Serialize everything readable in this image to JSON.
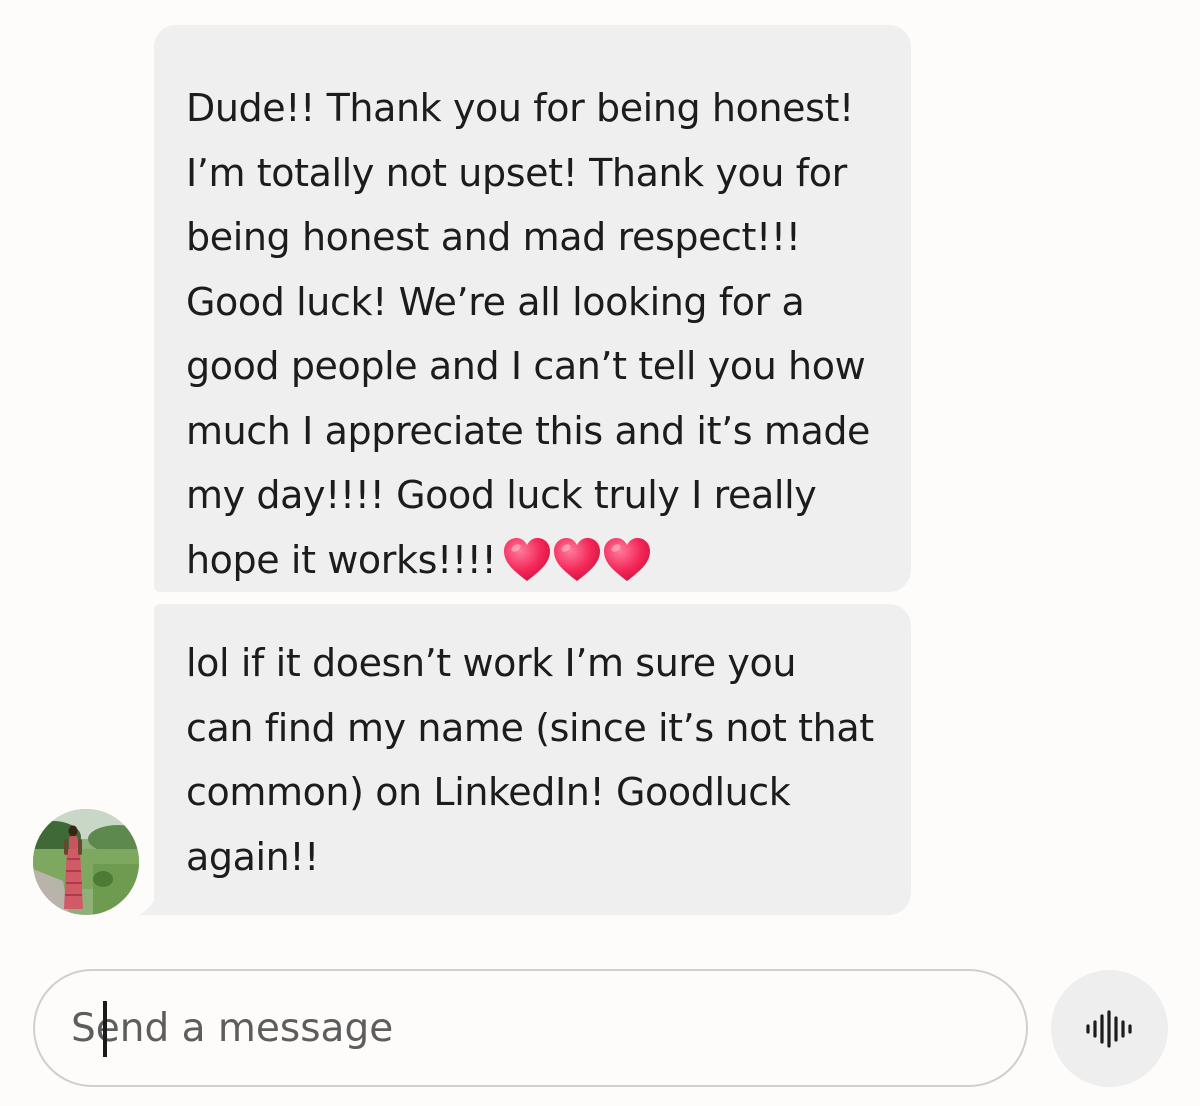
{
  "thread": {
    "messages": [
      {
        "lines": [
          "Dude!! Thank you for being honest!",
          "I’m totally not upset! Thank you for",
          "being honest and mad respect!!!",
          "Good luck! We’re all looking for a",
          "good people and I can’t tell you how",
          "much I appreciate this and it’s made",
          "my day!!!! Good luck truly I really",
          "hope it works!!!!"
        ],
        "emoji": [
          "heart-emoji",
          "heart-emoji",
          "heart-emoji"
        ]
      },
      {
        "lines": [
          "lol if it doesn’t work I’m sure you",
          "can find my name (since it’s not that",
          "common) on LinkedIn! Goodluck",
          "again!!"
        ]
      }
    ],
    "avatar": "sender-avatar-photo"
  },
  "composer": {
    "placeholder": "Send a message",
    "value": "",
    "voice_icon": "voice-waveform-icon"
  },
  "colors": {
    "background": "#fdfcfb",
    "bubble": "#efefef",
    "text": "#1c1c1c",
    "heart": "#f4285a"
  }
}
